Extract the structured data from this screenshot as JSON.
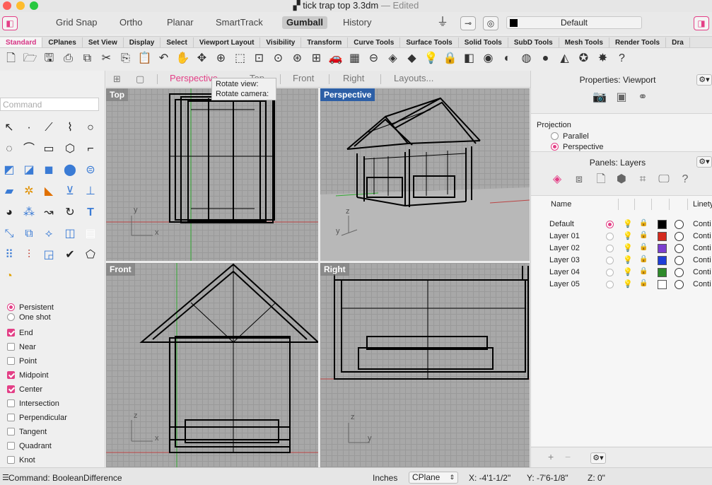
{
  "window": {
    "title": "tick trap top 3.3dm",
    "edited": "— Edited"
  },
  "toolbar": {
    "toggles": [
      "Grid Snap",
      "Ortho",
      "Planar",
      "SmartTrack",
      "Gumball",
      "History"
    ],
    "active_toggle": "Gumball",
    "layer_select": "Default"
  },
  "tabs": [
    "Standard",
    "CPlanes",
    "Set View",
    "Display",
    "Select",
    "Viewport Layout",
    "Visibility",
    "Transform",
    "Curve Tools",
    "Surface Tools",
    "Solid Tools",
    "SubD Tools",
    "Mesh Tools",
    "Render Tools",
    "Dra"
  ],
  "active_tab": "Standard",
  "command": {
    "placeholder": "Command",
    "last": "Command: BooleanDifference"
  },
  "osnap": {
    "persistent": "Persistent",
    "one_shot": "One shot",
    "items": [
      {
        "label": "End",
        "checked": true
      },
      {
        "label": "Near",
        "checked": false
      },
      {
        "label": "Point",
        "checked": false
      },
      {
        "label": "Midpoint",
        "checked": true
      },
      {
        "label": "Center",
        "checked": true
      },
      {
        "label": "Intersection",
        "checked": false
      },
      {
        "label": "Perpendicular",
        "checked": false
      },
      {
        "label": "Tangent",
        "checked": false
      },
      {
        "label": "Quadrant",
        "checked": false
      },
      {
        "label": "Knot",
        "checked": false
      }
    ]
  },
  "viewport_tabs": {
    "perspective": "Perspective",
    "top": "Top",
    "front": "Front",
    "right": "Right",
    "layouts": "Layouts..."
  },
  "tooltip": {
    "line1": "Rotate view:",
    "line2": "Rotate camera:"
  },
  "viewports": {
    "top": "Top",
    "perspective": "Perspective",
    "front": "Front",
    "right": "Right"
  },
  "axes": {
    "x": "x",
    "y": "y",
    "z": "z"
  },
  "properties": {
    "title": "Properties: Viewport",
    "projection_label": "Projection",
    "parallel": "Parallel",
    "perspective": "Perspective"
  },
  "layers_panel": {
    "title": "Panels: Layers",
    "col_name": "Name",
    "col_linetype": "Linety",
    "rows": [
      {
        "name": "Default",
        "color": "#000000",
        "current": true
      },
      {
        "name": "Layer 01",
        "color": "#d42a1e",
        "current": false
      },
      {
        "name": "Layer 02",
        "color": "#7b3fcf",
        "current": false
      },
      {
        "name": "Layer 03",
        "color": "#1e3ed8",
        "current": false
      },
      {
        "name": "Layer 04",
        "color": "#2e8a2a",
        "current": false
      },
      {
        "name": "Layer 05",
        "color": "#ffffff",
        "current": false
      }
    ],
    "linetype": "Conti"
  },
  "status": {
    "units": "Inches",
    "cplane": "CPlane",
    "x": "X: -4'1-1/2\"",
    "y": "Y: -7'6-1/8\"",
    "z": "Z: 0\""
  }
}
